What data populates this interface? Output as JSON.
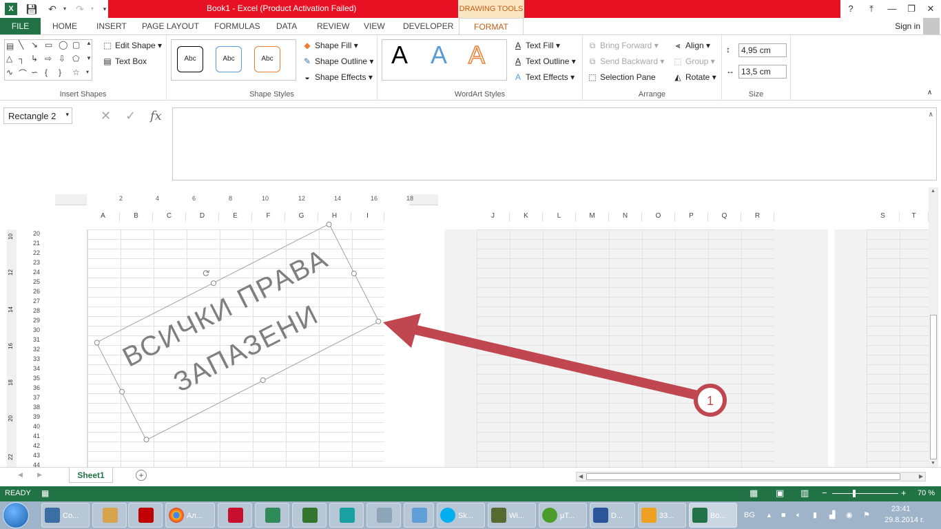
{
  "titlebar": {
    "title": "Book1 -  Excel (Product Activation Failed)",
    "context_tab": "DRAWING TOOLS",
    "help": "?",
    "minimize": "—",
    "restore": "❐",
    "close": "✕"
  },
  "tabs": {
    "file": "FILE",
    "items": [
      "HOME",
      "INSERT",
      "PAGE LAYOUT",
      "FORMULAS",
      "DATA",
      "REVIEW",
      "VIEW",
      "DEVELOPER"
    ],
    "active": "FORMAT",
    "signin": "Sign in"
  },
  "ribbon": {
    "insert_shapes": {
      "label": "Insert Shapes",
      "edit_shape": "Edit Shape",
      "text_box": "Text Box"
    },
    "shape_styles": {
      "label": "Shape Styles",
      "sample": "Abc",
      "fill": "Shape Fill",
      "outline": "Shape Outline",
      "effects": "Shape Effects"
    },
    "wordart_styles": {
      "label": "WordArt Styles",
      "sample": "A",
      "text_fill": "Text Fill",
      "text_outline": "Text Outline",
      "text_effects": "Text Effects"
    },
    "arrange": {
      "label": "Arrange",
      "bring_forward": "Bring Forward",
      "send_backward": "Send Backward",
      "selection_pane": "Selection Pane",
      "align": "Align",
      "group": "Group",
      "rotate": "Rotate"
    },
    "size": {
      "label": "Size",
      "height": "4,95 cm",
      "width": "13,5 cm"
    }
  },
  "formula_bar": {
    "name_box": "Rectangle 2",
    "fx": "fx",
    "formula": ""
  },
  "sheet": {
    "ruler": [
      "2",
      "4",
      "6",
      "8",
      "10",
      "12",
      "14",
      "16",
      "18"
    ],
    "columns_page1": [
      "A",
      "B",
      "C",
      "D",
      "E",
      "F",
      "G",
      "H",
      "I"
    ],
    "columns_page2": [
      "J",
      "K",
      "L",
      "M",
      "N",
      "O",
      "P",
      "Q",
      "R"
    ],
    "columns_page3": [
      "S",
      "T"
    ],
    "rows": [
      "20",
      "21",
      "22",
      "23",
      "24",
      "25",
      "26",
      "27",
      "28",
      "29",
      "30",
      "31",
      "32",
      "33",
      "34",
      "35",
      "36",
      "37",
      "38",
      "39",
      "40",
      "41",
      "42",
      "43",
      "44"
    ],
    "vruler": [
      "10",
      "12",
      "14",
      "16",
      "18",
      "20",
      "22"
    ],
    "wordart_line1": "ВСИЧКИ ПРАВА",
    "wordart_line2": "ЗАПАЗЕНИ",
    "callout_number": "1"
  },
  "sheet_tabs": {
    "active": "Sheet1"
  },
  "status": {
    "ready": "READY",
    "zoom": "70 %"
  },
  "taskbar": {
    "items": [
      "Co...",
      "",
      "",
      "Ал...",
      "",
      "",
      "",
      "",
      "",
      "",
      "Sk...",
      "Wi...",
      "µT...",
      "D...",
      "33...",
      "Bo..."
    ],
    "lang": "BG",
    "time": "23:41",
    "date": "29.8.2014 г."
  },
  "colors": {
    "excel_green": "#217346",
    "title_red": "#e81123",
    "format_orange": "#c55a11",
    "arrow_red": "#c0474f"
  }
}
